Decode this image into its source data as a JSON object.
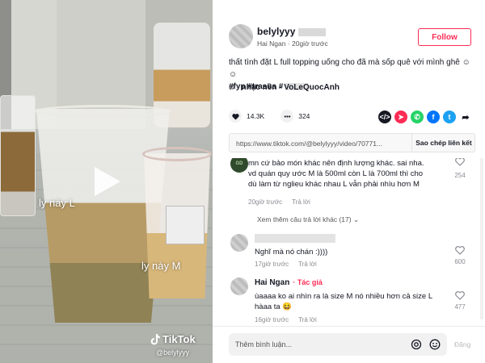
{
  "video": {
    "overlay_left": "ly này L",
    "overlay_right": "ly này M",
    "logo_text": "TikTok",
    "handle": "@belylyyy"
  },
  "author": {
    "username": "belylyyy",
    "name": "Hai Ngan",
    "time": "20giờ trước",
    "follow_label": "Follow"
  },
  "caption": {
    "text": "thất tình đặt L full topping uống cho đã mà sốp quê với mình ghê ☺ ☺",
    "tags": "#fyp #trasua #",
    "music": "nhạc nền - VoLeQuocAnh"
  },
  "stats": {
    "likes": "14.3K",
    "comments": "324"
  },
  "share_icons": [
    "embed-icon",
    "send-icon",
    "whatsapp-icon",
    "facebook-icon",
    "twitter-icon",
    "share-arrow-icon"
  ],
  "share_colors": {
    "embed": "#161823",
    "send": "#fe2c55",
    "whatsapp": "#25d366",
    "facebook": "#0075fa",
    "twitter": "#1da1f2"
  },
  "link": {
    "url": "https://www.tiktok.com/@belylyyy/video/70771...",
    "copy_label": "Sao chép liên kết"
  },
  "comments": [
    {
      "text_lines": [
        "mn cứ bảo món khác nên định lượng khác. sai nha.",
        "vd quán quy ước M là 500ml còn L là 700ml thì cho",
        "dù làm từ nglieu khác nhau L vẫn phải nhìu hơn M"
      ],
      "time": "20giờ trước",
      "reply": "Trả lời",
      "likes": "254",
      "view_more": "Xem thêm câu trả lời khác (17)"
    },
    {
      "text": "Nghĩ mà nó chán :))))",
      "time": "17giờ trước",
      "reply": "Trả lời",
      "likes": "600"
    },
    {
      "name": "Hai Ngan",
      "author_badge": "· Tác giả",
      "text_lines": [
        "ùaaaa ko ai nhìn ra là size M nó nhiều hơn cả size L",
        "hàaa ta 😆"
      ],
      "time": "16giờ trước",
      "reply": "Trả lời",
      "likes": "477"
    }
  ],
  "footer": {
    "placeholder": "Thêm bình luận...",
    "post_label": "Đăng"
  }
}
